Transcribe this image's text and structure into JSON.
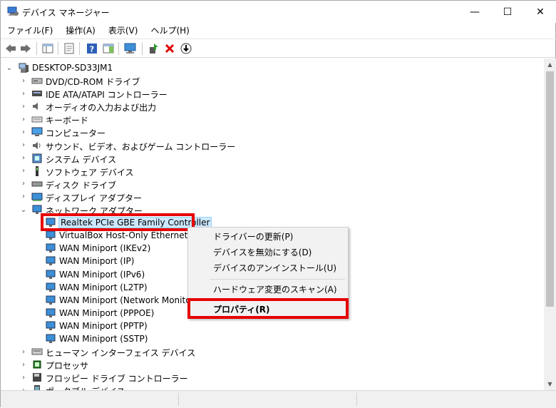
{
  "window": {
    "title": "デバイス マネージャー",
    "minimize": "—",
    "maximize": "☐",
    "close": "✕"
  },
  "menu": [
    "ファイル(F)",
    "操作(A)",
    "表示(V)",
    "ヘルプ(H)"
  ],
  "tree": {
    "root": "DESKTOP-SD33JM1",
    "categories": [
      {
        "label": "DVD/CD-ROM ドライブ",
        "icon": "dvd-drive-icon"
      },
      {
        "label": "IDE ATA/ATAPI コントローラー",
        "icon": "ide-controller-icon"
      },
      {
        "label": "オーディオの入力および出力",
        "icon": "speaker-icon"
      },
      {
        "label": "キーボード",
        "icon": "keyboard-icon"
      },
      {
        "label": "コンピューター",
        "icon": "computer-icon"
      },
      {
        "label": "サウンド、ビデオ、およびゲーム コントローラー",
        "icon": "sound-icon"
      },
      {
        "label": "システム デバイス",
        "icon": "system-device-icon"
      },
      {
        "label": "ソフトウェア デバイス",
        "icon": "software-device-icon"
      },
      {
        "label": "ディスク ドライブ",
        "icon": "disk-drive-icon"
      },
      {
        "label": "ディスプレイ アダプター",
        "icon": "display-adapter-icon"
      },
      {
        "label": "ネットワーク アダプター",
        "icon": "network-adapter-icon"
      }
    ],
    "network_children": [
      "Realtek PCIe GBE Family Controller",
      "VirtualBox Host-Only Ethernet Ada",
      "WAN Miniport (IKEv2)",
      "WAN Miniport (IP)",
      "WAN Miniport (IPv6)",
      "WAN Miniport (L2TP)",
      "WAN Miniport (Network Monitor)",
      "WAN Miniport (PPPOE)",
      "WAN Miniport (PPTP)",
      "WAN Miniport (SSTP)"
    ],
    "after": [
      {
        "label": "ヒューマン インターフェイス デバイス",
        "icon": "hid-icon"
      },
      {
        "label": "プロセッサ",
        "icon": "processor-icon"
      },
      {
        "label": "フロッピー ドライブ コントローラー",
        "icon": "floppy-controller-icon"
      },
      {
        "label": "ポータブル デバイス",
        "icon": "portable-device-icon"
      }
    ]
  },
  "context_menu": {
    "update_driver": "ドライバーの更新(P)",
    "disable_device": "デバイスを無効にする(D)",
    "uninstall_device": "デバイスのアンインストール(U)",
    "scan_hardware": "ハードウェア変更のスキャン(A)",
    "properties": "プロパティ(R)"
  },
  "colors": {
    "highlight": "#e60000",
    "selection": "#cce8ff"
  }
}
